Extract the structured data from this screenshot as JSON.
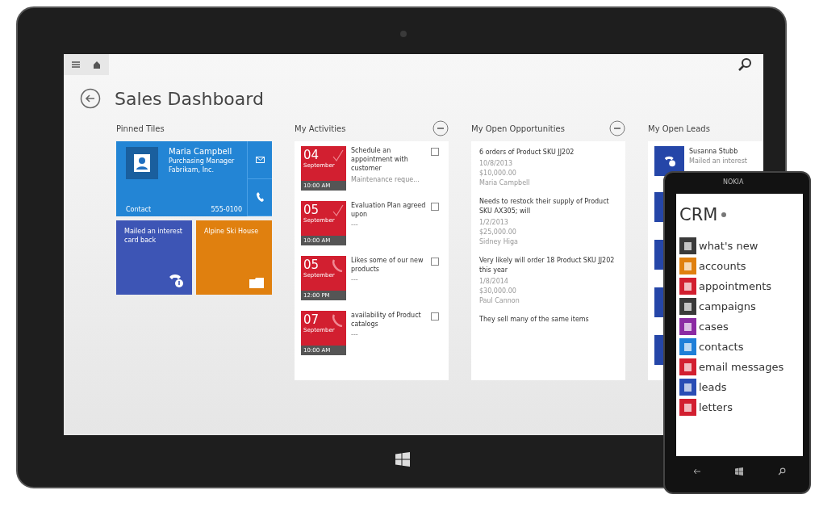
{
  "page": {
    "title": "Sales Dashboard"
  },
  "pinned": {
    "title": "Pinned Tiles",
    "contact": {
      "name": "Maria Campbell",
      "job_title": "Purchasing Manager",
      "company": "Fabrikam, Inc.",
      "type": "Contact",
      "phone": "555-0100"
    },
    "tiles": [
      {
        "text": "Mailed an interest card back",
        "color": "#3d55b5",
        "kind": "call"
      },
      {
        "text": "Alpine Ski House",
        "color": "#e0800f",
        "kind": "account"
      }
    ]
  },
  "activities": {
    "title": "My Activities",
    "items": [
      {
        "day": "04",
        "month": "September",
        "time": "10:00 AM",
        "subject": "Schedule an appointment with customer",
        "detail": "Maintenance reque...",
        "kind": "task",
        "checked": false
      },
      {
        "day": "05",
        "month": "September",
        "time": "10:00 AM",
        "subject": "Evaluation Plan agreed upon",
        "detail": "---",
        "kind": "task",
        "checked": false
      },
      {
        "day": "05",
        "month": "September",
        "time": "12:00 PM",
        "subject": "Likes some of our new products",
        "detail": "---",
        "kind": "call",
        "checked": false
      },
      {
        "day": "07",
        "month": "September",
        "time": "10:00 AM",
        "subject": "availability of Product catalogs",
        "detail": "---",
        "kind": "call",
        "checked": false
      }
    ]
  },
  "opportunities": {
    "title": "My Open Opportunities",
    "items": [
      {
        "name": "6 orders of Product SKU JJ202",
        "date": "10/8/2013",
        "amount": "$10,000.00",
        "owner": "Maria Campbell"
      },
      {
        "name": "Needs to restock their supply of Product SKU AX305; will",
        "date": "1/2/2013",
        "amount": "$25,000.00",
        "owner": "Sidney Higa"
      },
      {
        "name": "Very likely will order 18 Product SKU JJ202 this year",
        "date": "1/8/2014",
        "amount": "$30,000.00",
        "owner": "Paul Cannon"
      },
      {
        "name": "They sell many of the same items"
      }
    ]
  },
  "leads": {
    "title": "My Open Leads",
    "items": [
      {
        "name": "Susanna Stubb",
        "detail": "Mailed an interest"
      }
    ]
  },
  "phone": {
    "brand": "NOKIA",
    "app_title": "CRM",
    "menu": [
      {
        "label": "what's new",
        "color": "#3a3a3a"
      },
      {
        "label": "accounts",
        "color": "#e0800f"
      },
      {
        "label": "appointments",
        "color": "#d21f30"
      },
      {
        "label": "campaigns",
        "color": "#3a3a3a"
      },
      {
        "label": "cases",
        "color": "#8b2ba3"
      },
      {
        "label": "contacts",
        "color": "#1f7fd8"
      },
      {
        "label": "email messages",
        "color": "#d21f30"
      },
      {
        "label": "leads",
        "color": "#2a4db5"
      },
      {
        "label": "letters",
        "color": "#d21f30"
      }
    ]
  }
}
